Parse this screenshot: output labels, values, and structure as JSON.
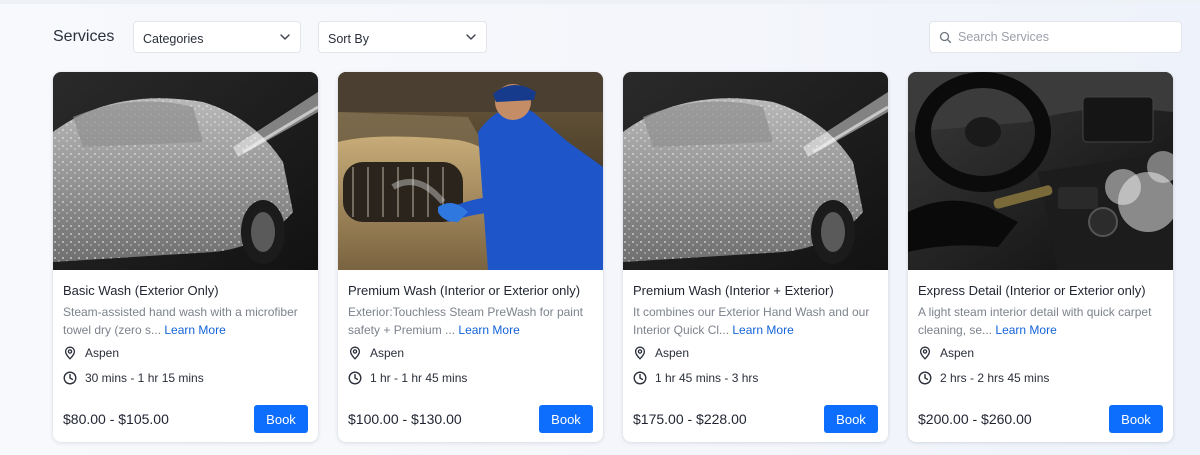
{
  "header": {
    "title": "Services",
    "categories_label": "Categories",
    "sort_label": "Sort By",
    "search_placeholder": "Search Services"
  },
  "cards": [
    {
      "title": "Basic Wash (Exterior Only)",
      "desc": "Steam-assisted hand wash with a microfiber towel dry (zero s...",
      "learn_more": "Learn More",
      "location": "Aspen",
      "duration": "30 mins - 1 hr 15 mins",
      "price": "$80.00 - $105.00",
      "book": "Book",
      "image": "car-wash-spray"
    },
    {
      "title": "Premium Wash (Interior or Exterior only)",
      "desc": "Exterior:Touchless Steam PreWash for paint safety + Premium ...",
      "learn_more": "Learn More",
      "location": "Aspen",
      "duration": "1 hr - 1 hr 45 mins",
      "price": "$100.00 - $130.00",
      "book": "Book",
      "image": "detailer-polishing-car"
    },
    {
      "title": "Premium Wash (Interior + Exterior)",
      "desc": "It combines our Exterior Hand Wash and our Interior Quick Cl...",
      "learn_more": "Learn More",
      "location": "Aspen",
      "duration": "1 hr 45 mins - 3 hrs",
      "price": "$175.00 - $228.00",
      "book": "Book",
      "image": "car-wash-spray"
    },
    {
      "title": "Express Detail (Interior or Exterior only)",
      "desc": "A light steam interior detail with quick carpet cleaning, se...",
      "learn_more": "Learn More",
      "location": "Aspen",
      "duration": "2 hrs - 2 hrs 45 mins",
      "price": "$200.00 - $260.00",
      "book": "Book",
      "image": "interior-steam-clean"
    }
  ],
  "colors": {
    "accent": "#0d6efd",
    "link": "#1463d9"
  }
}
